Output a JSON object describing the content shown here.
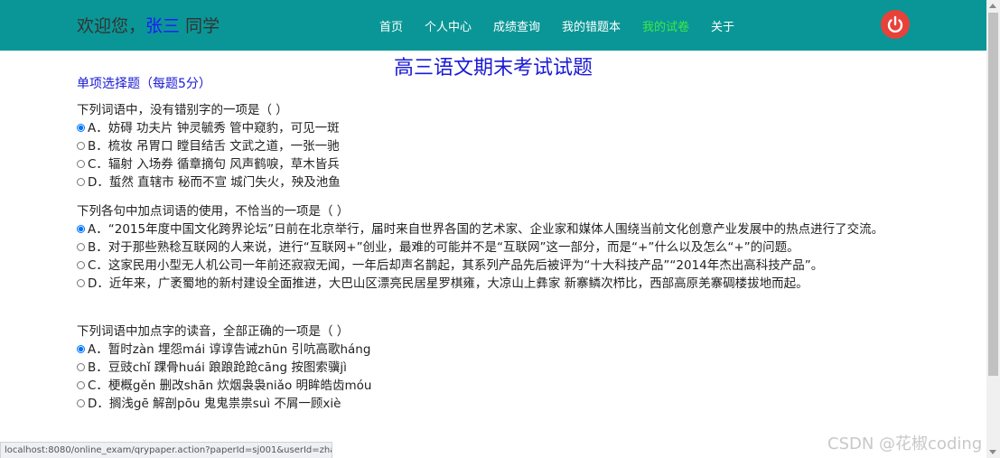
{
  "header": {
    "welcome_prefix": "欢迎您，",
    "user_name": "张三",
    "welcome_suffix": " 同学",
    "nav": [
      {
        "label": "首页"
      },
      {
        "label": "个人中心"
      },
      {
        "label": "成绩查询"
      },
      {
        "label": "我的错题本"
      },
      {
        "label": "我的试卷",
        "active": true
      },
      {
        "label": "关于"
      }
    ],
    "power_icon": "power-icon",
    "bar_color": "#0a9696",
    "active_color": "#3fe84a"
  },
  "exam": {
    "title": "高三语文期末考试试题",
    "section": "单项选择题（每题5分）",
    "questions": [
      {
        "stem": "下列词语中，没有错别字的一项是（ ）",
        "options": [
          {
            "text": "A．妨碍 功夫片 钟灵毓秀 管中窥豹，可见一斑",
            "checked": true
          },
          {
            "text": "B．梳妆 吊胃口 瞠目结舌 文武之道，一张一驰",
            "checked": false
          },
          {
            "text": "C．辐射 入场券 循章摘句 风声鹤唳，草木皆兵",
            "checked": false
          },
          {
            "text": "D．蜇然 直辖市 秘而不宣 城门失火，殃及池鱼",
            "checked": false
          }
        ]
      },
      {
        "stem": "下列各句中加点词语的使用，不恰当的一项是（ ）",
        "options": [
          {
            "text": "A．“2015年度中国文化跨界论坛”日前在北京举行，届时来自世界各国的艺术家、企业家和媒体人围绕当前文化创意产业发展中的热点进行了交流。",
            "checked": true
          },
          {
            "text": "B．对于那些熟稔互联网的人来说，进行“互联网+”创业，最难的可能并不是“互联网”这一部分，而是“+”什么以及怎么“+”的问题。",
            "checked": false
          },
          {
            "text": "C．这家民用小型无人机公司一年前还寂寂无闻，一年后却声名鹊起，其系列产品先后被评为“十大科技产品”“2014年杰出高科技产品”。",
            "checked": false
          },
          {
            "text": "D．近年来，广袤蜀地的新村建设全面推进，大巴山区漂亮民居星罗棋雍，大凉山上彝家 新寨鳞次栉比，西部高原羌寨碉楼拔地而起。",
            "checked": false
          }
        ]
      },
      {
        "stem": "下列词语中加点字的读音，全部正确的一项是（ ）",
        "options": [
          {
            "text": "A．暂时zàn 埋怨mái 谆谆告诫zhūn 引吭高歌háng",
            "checked": true
          },
          {
            "text": "B．豆豉chǐ 踝骨huái 踉踉跄跄cāng 按图索骥jì",
            "checked": false
          },
          {
            "text": "C．梗概gěn 删改shān 炊烟袅袅niǎo 明眸皓齿móu",
            "checked": false
          },
          {
            "text": "D．搁浅gē 解剖pōu 鬼鬼祟祟suì 不屑一顾xiè",
            "checked": false
          }
        ]
      }
    ]
  },
  "status_bar": {
    "url": "localhost:8080/online_exam/qrypaper.action?paperId=sj001&userId=zhan..."
  },
  "watermark": "CSDN @花椒coding"
}
